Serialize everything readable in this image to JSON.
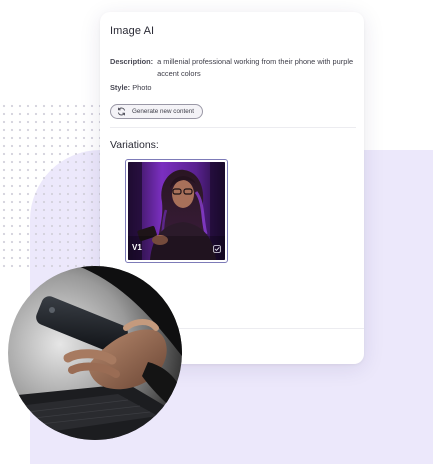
{
  "card": {
    "title": "Image AI",
    "description_label": "Description:",
    "description_value": "a millenial professional working from their phone with purple accent colors",
    "style_label": "Style:",
    "style_value": "Photo",
    "generate_button_label": "Generate new content",
    "variations_label": "Variations:"
  },
  "variations": [
    {
      "label": "V1",
      "selected": true
    }
  ],
  "icons": {
    "generate": "refresh-icon",
    "variation_select": "checkbox-icon"
  },
  "colors": {
    "background_shape": "#ece8fb",
    "card": "#ffffff",
    "variation_border": "#7d7bb8",
    "portrait_purple": "#7b2fc0"
  }
}
